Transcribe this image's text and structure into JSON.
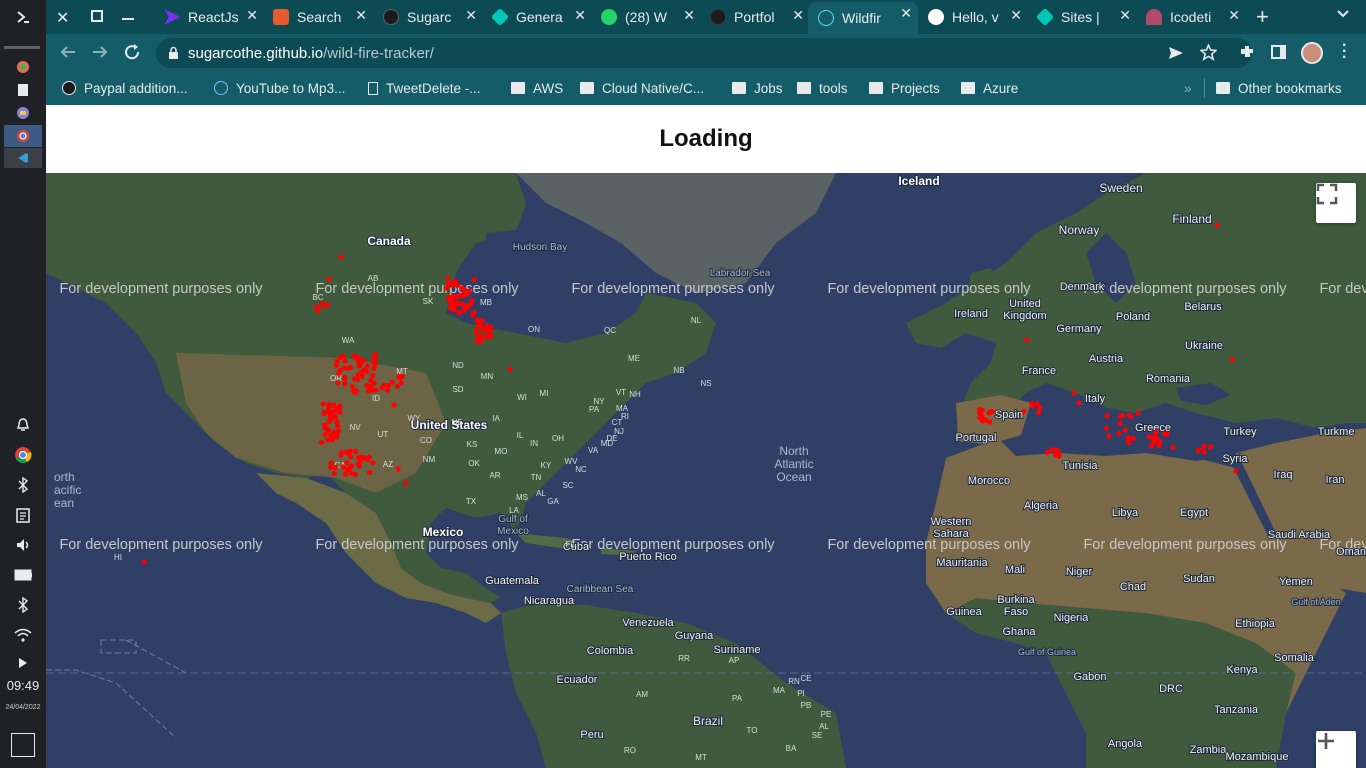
{
  "system": {
    "clock": "09:49",
    "date": "24/04/2022",
    "icons": [
      "launcher-icon",
      "app-icon",
      "files-icon",
      "app-icon",
      "chrome-icon",
      "vscode-icon",
      "bell-icon",
      "chrome-icon",
      "bluetooth-icon",
      "clipboard-icon",
      "volume-icon",
      "battery-icon",
      "bluetooth-icon",
      "wifi-icon",
      "play-icon",
      "overview-icon"
    ]
  },
  "tabs": [
    {
      "title": "ReactJs",
      "color": "#7b2ff7"
    },
    {
      "title": "Search",
      "color": "#e55b2d"
    },
    {
      "title": "Sugarc",
      "color": "#1b1b1b"
    },
    {
      "title": "Genera",
      "color": "#00c7b7"
    },
    {
      "title": "(28) W",
      "color": "#25d366"
    },
    {
      "title": "Portfol",
      "color": "#1b1b1b"
    },
    {
      "title": "Wildfir",
      "color": "#61dafb"
    },
    {
      "title": "Hello, v",
      "color": "#ffffff"
    },
    {
      "title": "Sites |",
      "color": "#00c7b7"
    },
    {
      "title": "Icodeti",
      "color": "#b24a6a"
    }
  ],
  "address": {
    "domain": "sugarcothe.github.io",
    "path": "/wild-fire-tracker/"
  },
  "bookmarks": [
    "Paypal addition...",
    "YouTube to Mp3...",
    "TweetDelete -...",
    "AWS",
    "Cloud Native/C...",
    "Jobs",
    "tools",
    "Projects",
    "Azure"
  ],
  "bookmarks_overflow": "»",
  "other_bookmarks": "Other bookmarks",
  "page": {
    "title": "Loading"
  },
  "map": {
    "watermark": "For development purposes only",
    "fire_color": "#ff0000",
    "labels": {
      "canada": "Canada",
      "hudson_bay": "Hudson Bay",
      "labrador_sea": "Labrador Sea",
      "iceland": "Iceland",
      "sweden": "Sweden",
      "finland": "Finland",
      "norway": "Norway",
      "united_states": "United States",
      "mexico": "Mexico",
      "gulf_of_mexico": "Gulf of Mexico",
      "north_atlantic_ocean": "North Atlantic Ocean",
      "north_pacific_ocean": "orth acific ean",
      "cuba": "Cuba",
      "puerto_rico": "Puerto Rico",
      "guatemala": "Guatemala",
      "nicaragua": "Nicaragua",
      "caribbean_sea": "Caribbean Sea",
      "venezuela": "Venezuela",
      "guyana": "Guyana",
      "suriname": "Suriname",
      "colombia": "Colombia",
      "ecuador": "Ecuador",
      "peru": "Peru",
      "brazil": "Brazil",
      "united_kingdom": "United Kingdom",
      "ireland": "Ireland",
      "denmark": "Denmark",
      "belarus": "Belarus",
      "poland": "Poland",
      "germany": "Germany",
      "ukraine": "Ukraine",
      "austria": "Austria",
      "france": "France",
      "romania": "Romania",
      "italy": "Italy",
      "spain": "Spain",
      "portugal": "Portugal",
      "greece": "Greece",
      "turkey": "Turkey",
      "turkmenistan": "Turkme",
      "syria": "Syria",
      "iraq": "Iraq",
      "iran": "Iran",
      "tunisia": "Tunisia",
      "morocco": "Morocco",
      "algeria": "Algeria",
      "libya": "Libya",
      "egypt": "Egypt",
      "saudi_arabia": "Saudi Arabia",
      "oman": "Oman",
      "western_sahara": "Western Sahara",
      "mauritania": "Mauritania",
      "mali": "Mali",
      "niger": "Niger",
      "chad": "Chad",
      "sudan": "Sudan",
      "yemen": "Yemen",
      "gulf_of_aden": "Gulf of Aden",
      "guinea": "Guinea",
      "burkina_faso": "Burkina Faso",
      "nigeria": "Nigeria",
      "ethiopia": "Ethiopia",
      "ghana": "Ghana",
      "gulf_of_guinea": "Gulf of Guinea",
      "somalia": "Somalia",
      "kenya": "Kenya",
      "gabon": "Gabon",
      "drc": "DRC",
      "tanzania": "Tanzania",
      "angola": "Angola",
      "zambia": "Zambia",
      "mozambique": "Mozambique",
      "province_codes": [
        "BC",
        "AB",
        "SK",
        "MB",
        "ON",
        "QC",
        "NL",
        "NB",
        "NS"
      ],
      "state_codes": [
        "WA",
        "OR",
        "ID",
        "MT",
        "ND",
        "MN",
        "WI",
        "MI",
        "SD",
        "WY",
        "NE",
        "IA",
        "IL",
        "IN",
        "OH",
        "PA",
        "NY",
        "NV",
        "UT",
        "CO",
        "KS",
        "MO",
        "KY",
        "WV",
        "VA",
        "CA",
        "AZ",
        "NM",
        "OK",
        "AR",
        "TN",
        "NC",
        "SC",
        "MS",
        "AL",
        "GA",
        "TX",
        "LA",
        "FL",
        "ME",
        "VT",
        "NH",
        "MA",
        "CT",
        "NJ",
        "DE",
        "MD",
        "RI",
        "HI"
      ],
      "south_america_codes": [
        "AM",
        "PA",
        "RR",
        "AP",
        "MA",
        "CE",
        "PI",
        "PB",
        "PE",
        "AL",
        "SE",
        "BA",
        "TO",
        "RO",
        "MT",
        "RN"
      ]
    }
  }
}
